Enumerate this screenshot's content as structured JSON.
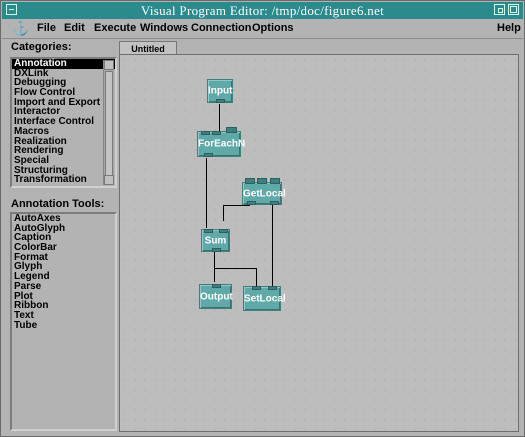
{
  "window": {
    "title": "Visual Program Editor: /tmp/doc/figure6.net"
  },
  "menubar": {
    "items": [
      "File",
      "Edit",
      "Execute",
      "Windows",
      "Connection",
      "Options"
    ],
    "help": "Help"
  },
  "categories": {
    "label": "Categories:",
    "items": [
      "Annotation",
      "DXLink",
      "Debugging",
      "Flow Control",
      "Import and Export",
      "Interactor",
      "Interface Control",
      "Macros",
      "Realization",
      "Rendering",
      "Special",
      "Structuring",
      "Transformation"
    ],
    "selected": "Annotation"
  },
  "tools": {
    "label": "Annotation Tools:",
    "items": [
      "AutoAxes",
      "AutoGlyph",
      "Caption",
      "ColorBar",
      "Format",
      "Glyph",
      "Legend",
      "Parse",
      "Plot",
      "Ribbon",
      "Text",
      "Tube"
    ]
  },
  "tab": {
    "label": "Untitled"
  },
  "nodes": {
    "input": "Input",
    "foreach": "ForEachN",
    "getlocal": "GetLocal",
    "sum": "Sum",
    "output": "Output",
    "setlocal": "SetLocal"
  },
  "colors": {
    "titlebar": "#2b8a8c",
    "node": "#5fa9a8",
    "selection": "#000000"
  }
}
